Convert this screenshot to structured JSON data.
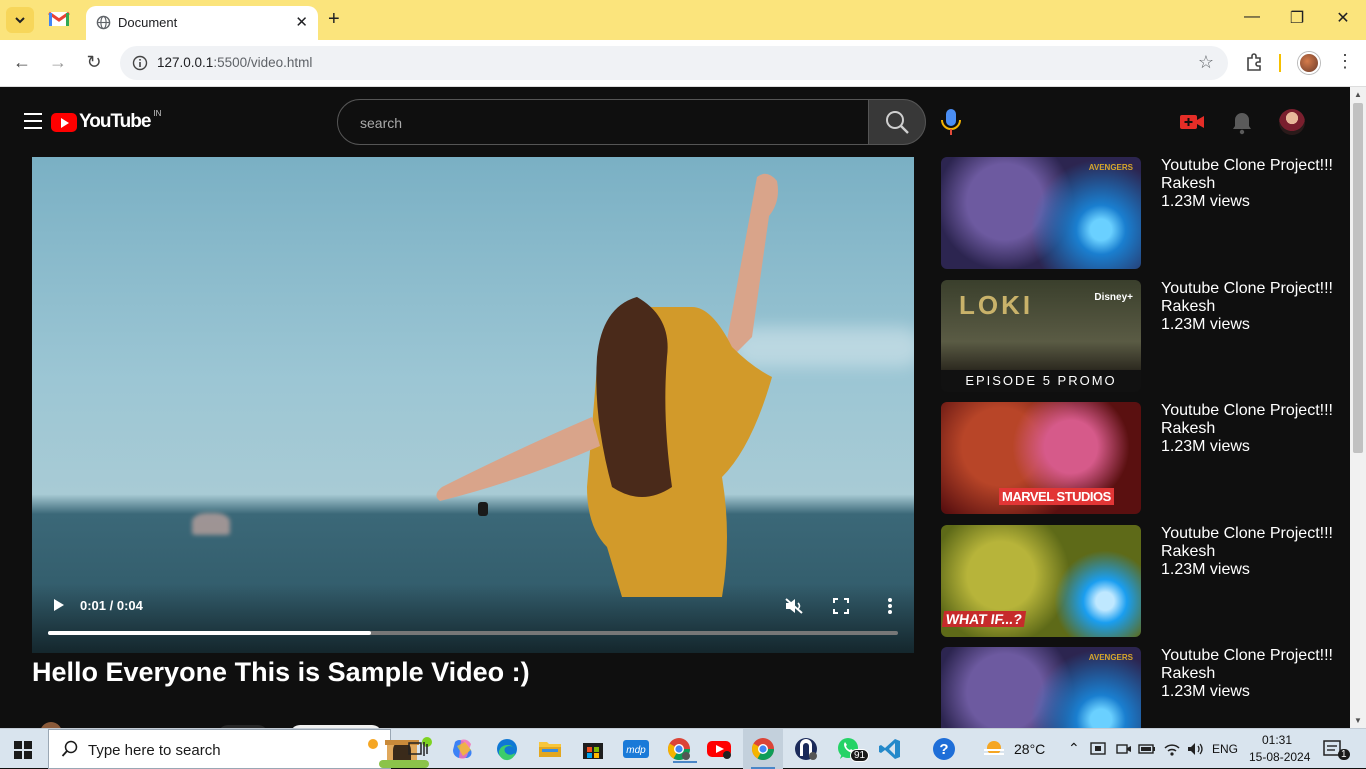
{
  "browser": {
    "tab_title": "Document",
    "url_host": "127.0.0.1",
    "url_path": ":5500/video.html"
  },
  "header": {
    "logo_text": "YouTube",
    "region": "IN",
    "search_placeholder": "search"
  },
  "player": {
    "time": "0:01 / 0:04",
    "progress": 0.38
  },
  "video_title": "Hello Everyone This is Sample Video :)",
  "recommendations": [
    {
      "title": "Youtube Clone Project!!!",
      "channel": "Rakesh",
      "views": "1.23M views",
      "thumb": "thanos",
      "overlay": ""
    },
    {
      "title": "Youtube Clone Project!!!",
      "channel": "Rakesh",
      "views": "1.23M views",
      "thumb": "loki",
      "overlay": "EPISODE 5 PROMO"
    },
    {
      "title": "Youtube Clone Project!!!",
      "channel": "Rakesh",
      "views": "1.23M views",
      "thumb": "wanda",
      "overlay": "MARVEL STUDIOS"
    },
    {
      "title": "Youtube Clone Project!!!",
      "channel": "Rakesh",
      "views": "1.23M views",
      "thumb": "whatif",
      "overlay": "WHAT IF...?"
    },
    {
      "title": "Youtube Clone Project!!!",
      "channel": "Rakesh",
      "views": "1.23M views",
      "thumb": "thanos",
      "overlay": ""
    }
  ],
  "thumb_text": {
    "loki": "LOKI",
    "disney": "Disney+",
    "avengers": "AVENGERS"
  },
  "taskbar": {
    "search_placeholder": "Type here to search",
    "temperature": "28°C",
    "language": "ENG",
    "time": "01:31",
    "date": "15-08-2024",
    "whatsapp_badge": "91",
    "notification_count": "1"
  },
  "colors": {
    "brand_red": "#ff0000",
    "background": "#0f0f0f",
    "chrome_tab_strip": "#fbe47c"
  }
}
